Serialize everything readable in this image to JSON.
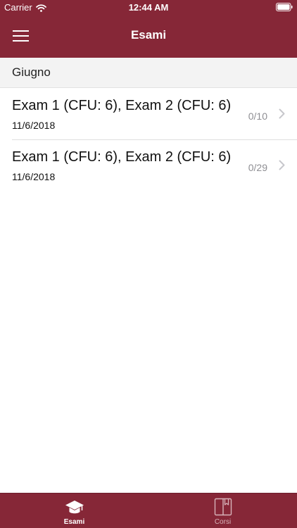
{
  "status_bar": {
    "carrier": "Carrier",
    "time": "12:44 AM"
  },
  "nav": {
    "title": "Esami",
    "menu_icon": "hamburger-menu-icon"
  },
  "section": {
    "title": "Giugno"
  },
  "exams": [
    {
      "title": "Exam 1 (CFU: 6), Exam 2 (CFU: 6)",
      "date": "11/6/2018",
      "count": "0/10"
    },
    {
      "title": "Exam 1 (CFU: 6), Exam 2 (CFU: 6)",
      "date": "11/6/2018",
      "count": "0/29"
    }
  ],
  "tabs": [
    {
      "label": "Esami",
      "icon": "graduation-cap-icon",
      "active": true
    },
    {
      "label": "Corsi",
      "icon": "book-icon",
      "active": false
    }
  ],
  "colors": {
    "brand": "#862737",
    "section_background": "#f3f3f3",
    "secondary_text": "#8e8e93",
    "inactive_tab": "#d7b3b9"
  }
}
